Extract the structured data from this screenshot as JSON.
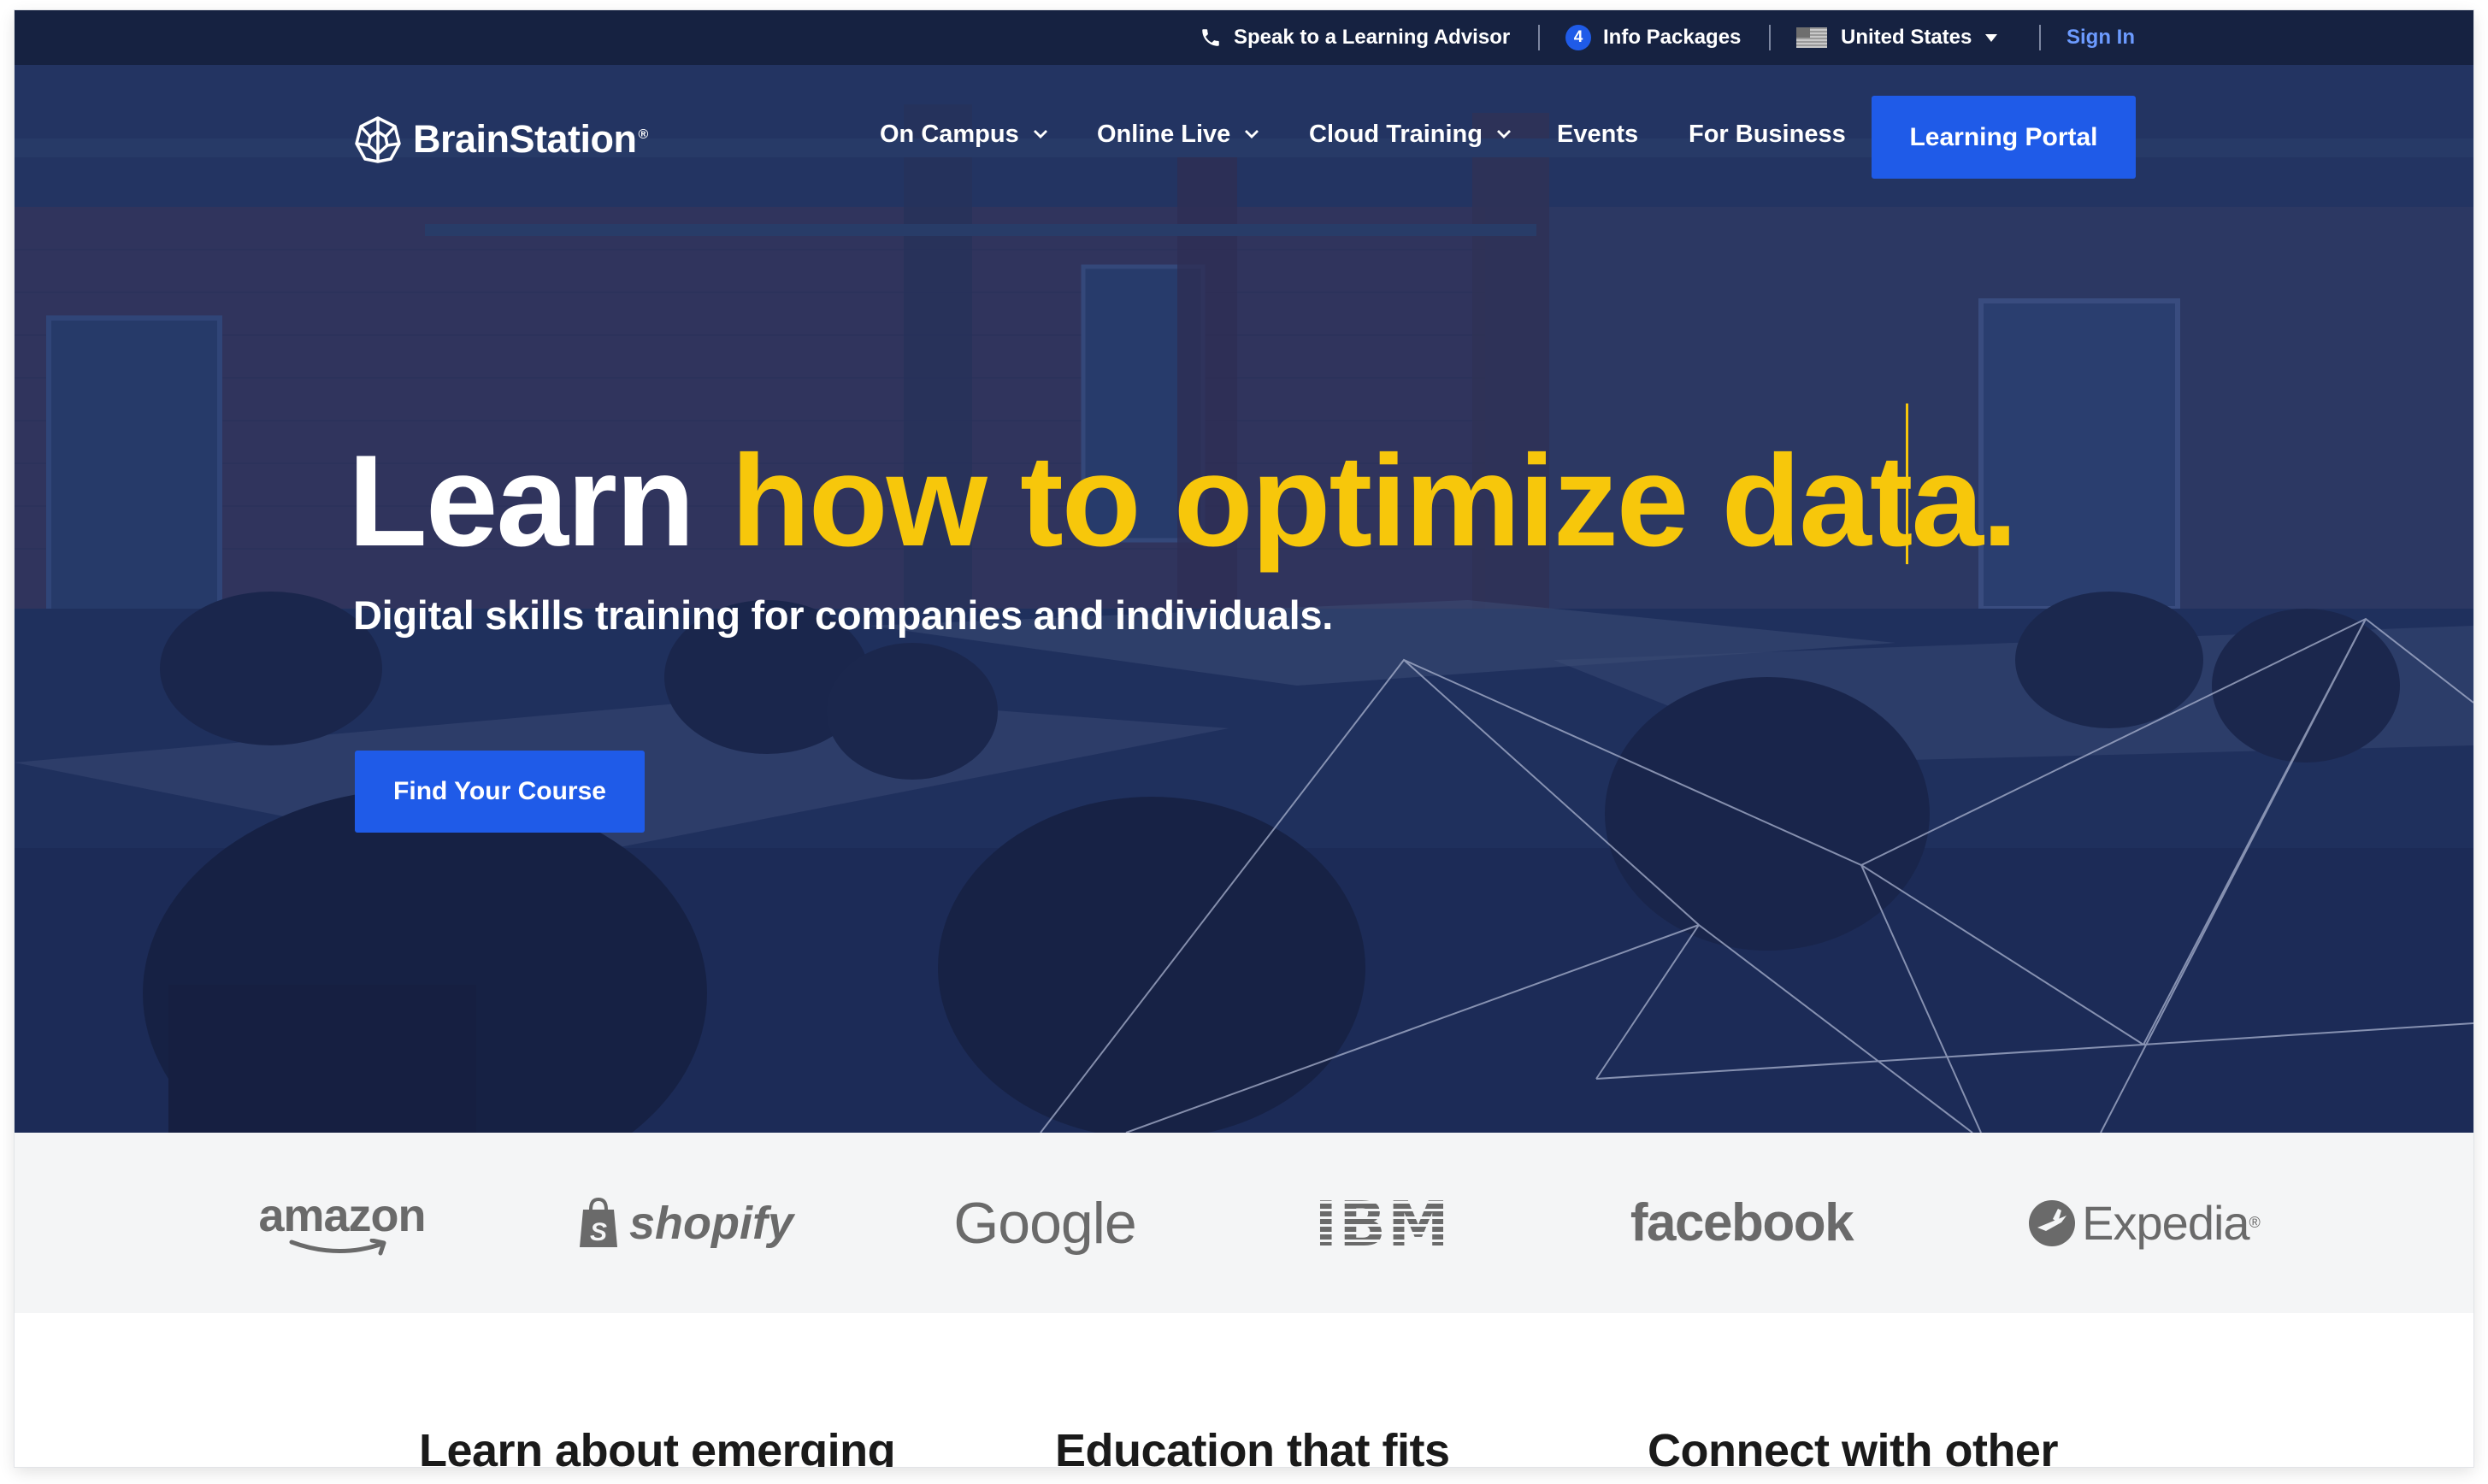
{
  "utility_bar": {
    "advisor_label": "Speak to a Learning Advisor",
    "info_count": "4",
    "info_label": "Info Packages",
    "country_label": "United States",
    "sign_in_label": "Sign In"
  },
  "nav": {
    "logo_text": "BrainStation",
    "logo_reg": "®",
    "items": [
      {
        "label": "On Campus"
      },
      {
        "label": "Online Live"
      },
      {
        "label": "Cloud Training"
      },
      {
        "label": "Events"
      },
      {
        "label": "For Business"
      }
    ],
    "portal_label": "Learning Portal"
  },
  "hero": {
    "headline_static": "Learn",
    "headline_typed": "how to optimize data.",
    "subheadline": "Digital skills training for companies and individuals.",
    "cta_label": "Find Your Course"
  },
  "clients": [
    {
      "name": "amazon"
    },
    {
      "name": "shopify"
    },
    {
      "name": "Google"
    },
    {
      "name": "IBM"
    },
    {
      "name": "facebook"
    },
    {
      "name": "Expedia",
      "reg": "®"
    }
  ],
  "features": [
    {
      "heading": "Learn about emerging"
    },
    {
      "heading": "Education that fits"
    },
    {
      "heading": "Connect with other"
    }
  ],
  "colors": {
    "accent_blue": "#1f5be8",
    "headline_yellow": "#f7c70b",
    "hero_navy": "#1e3060",
    "utility_bar": "#16213e",
    "sign_in_link": "#6c9bff",
    "logo_strip_bg": "#f4f5f6",
    "client_logo_grey": "#6a6a6a"
  },
  "icons": {
    "phone": "phone-icon",
    "us_flag": "us-flag-icon",
    "brain_logo": "brain-logo-icon",
    "chevron": "chevron-down-icon"
  }
}
